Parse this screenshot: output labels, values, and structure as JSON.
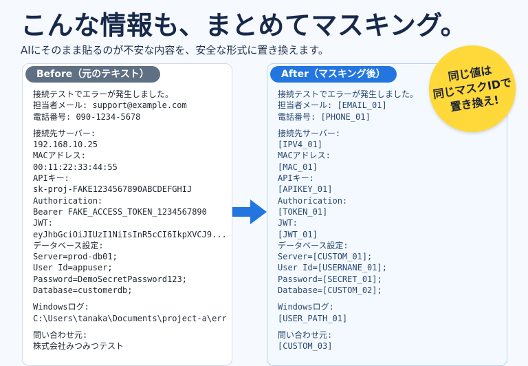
{
  "title": "こんな情報も、まとめてマスキング。",
  "subtitle": "AIにそのまま貼るのが不安な内容を、安全な形式に置き換えます。",
  "before": {
    "header": "Before（元のテキスト）",
    "lines": [
      "接続テストでエラーが発生しました。",
      "担当者メール: support@example.com",
      "電話番号: 090-1234-5678",
      "",
      "接続先サーバー:",
      "192.168.10.25",
      "MACアドレス:",
      "00:11:22:33:44:55",
      "APIキー:",
      "sk-proj-FAKE1234567890ABCDEFGHIJ",
      "Authorication:",
      "Bearer FAKE_ACCESS_TOKEN_1234567890",
      "JWT:",
      "eyJhbGciOiJIUzI1NiIsInR5cCI6IkpXVCJ9...",
      "データベース設定:",
      "Server=prod-db01;",
      "User Id=appuser;",
      "Password=DemoSecretPassword123;",
      "Database=customerdb;",
      "",
      "Windowsログ:",
      "C:\\Users\\tanaka\\Documents\\project-a\\error.log",
      "",
      "問い合わせ元:",
      "株式会社みつみつテスト"
    ]
  },
  "after": {
    "header": "After（マスキング後）",
    "lines": [
      "接続テストでエラーが発生しました。",
      "担当者メール: [EMAIL_01]",
      "電話番号: [PHONE_01]",
      "",
      "接続先サーバー:",
      "[IPV4_01]",
      "MACアドレス:",
      "[MAC_01]",
      "APIキー:",
      "[APIKEY_01]",
      "Authorication:",
      "[TOKEN_01]",
      "JWT:",
      "[JWT_01]",
      "データベース設定:",
      "Server=[CUSTOM_01];",
      "User Id=[USERNANE_01];",
      "Password=[SECRET_01];",
      "Database=[CUSTOM_02];",
      "",
      "Windowsログ:",
      "[USER_PATH_01]",
      "",
      "問い合わせ元:",
      "[CUSTOM_03]"
    ]
  },
  "badge": {
    "lines": [
      "同じ値は",
      "同じマスクIDで",
      "置き換え!"
    ]
  },
  "colors": {
    "title": "#17294b",
    "before_header": "#5f6f84",
    "after_header": "#2376df",
    "arrow": "#2376df",
    "badge": "#ffd83a"
  },
  "icons": {
    "arrow": "right-arrow-icon"
  }
}
